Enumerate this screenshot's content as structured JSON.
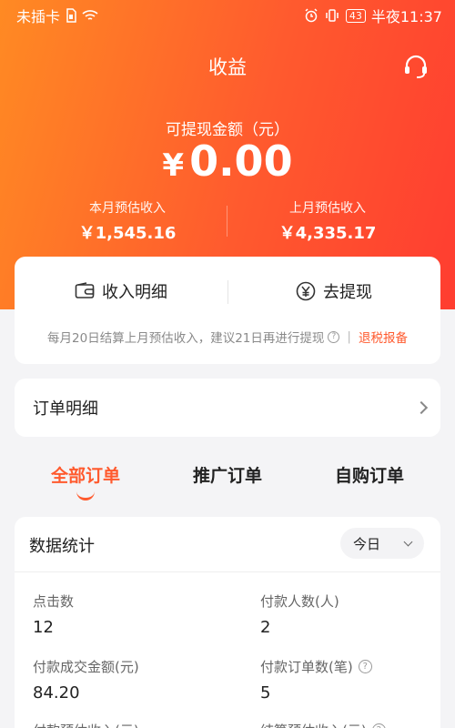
{
  "status_bar": {
    "carrier": "未插卡",
    "battery": "43",
    "time": "半夜11:37"
  },
  "header": {
    "title": "收益"
  },
  "balance": {
    "label": "可提现金额（元）",
    "currency": "¥",
    "amount": "0.00"
  },
  "month_estimates": {
    "this_month": {
      "label": "本月预估收入",
      "value": "￥1,545.16"
    },
    "last_month": {
      "label": "上月预估收入",
      "value": "￥4,335.17"
    }
  },
  "actions": {
    "income_detail": "收入明细",
    "withdraw": "去提现",
    "hint": "每月20日结算上月预估收入，建议21日再进行提现",
    "separator": "|",
    "tax_link": "退税报备"
  },
  "order_detail": {
    "label": "订单明细"
  },
  "tabs": [
    {
      "label": "全部订单"
    },
    {
      "label": "推广订单"
    },
    {
      "label": "自购订单"
    }
  ],
  "stats": {
    "title": "数据统计",
    "period": "今日",
    "items": [
      {
        "label": "点击数",
        "value": "12"
      },
      {
        "label": "付款人数(人)",
        "value": "2"
      },
      {
        "label": "付款成交金额(元)",
        "value": "84.20"
      },
      {
        "label": "付款订单数(笔)",
        "value": "5"
      },
      {
        "label": "付款预估收入(元)",
        "value": ""
      },
      {
        "label": "结算预估收入(元)",
        "value": ""
      }
    ]
  },
  "colors": {
    "accent": "#ff5a2e",
    "gradient_start": "#ff8a23",
    "gradient_end": "#ff3d30"
  }
}
